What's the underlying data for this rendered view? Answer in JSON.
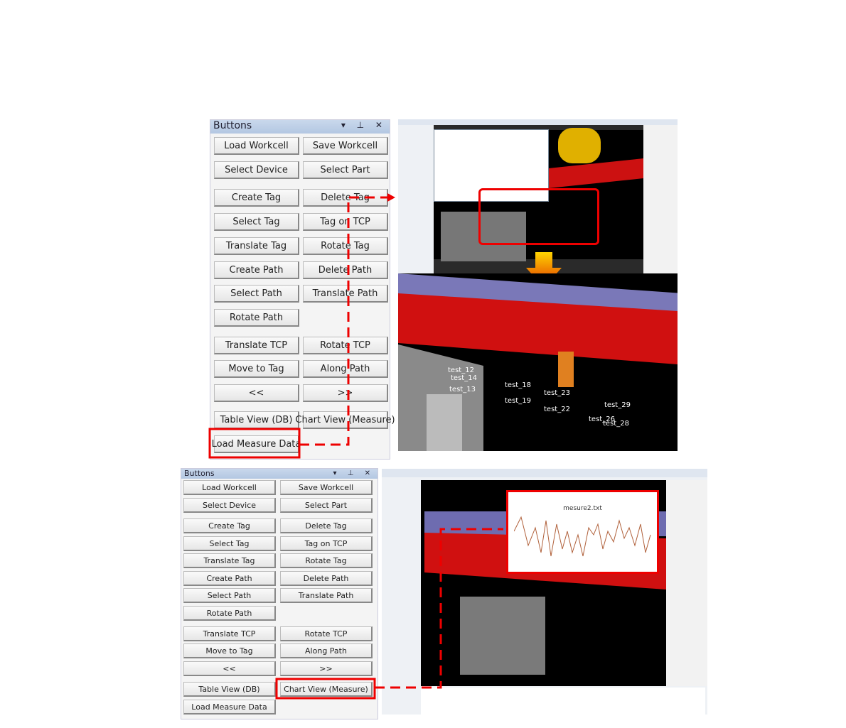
{
  "panel_title": "Buttons",
  "buttons": [
    [
      "Load Workcell",
      "Save Workcell"
    ],
    [
      "Select Device",
      "Select Part"
    ],
    [
      "Create Tag",
      "Delete Tag"
    ],
    [
      "Select Tag",
      "Tag on TCP"
    ],
    [
      "Translate Tag",
      "Rotate Tag"
    ],
    [
      "Create Path",
      "Delete Path"
    ],
    [
      "Select Path",
      "Translate Path"
    ],
    [
      "Rotate Path",
      ""
    ],
    [
      "Translate TCP",
      "Rotate TCP"
    ],
    [
      "Move to Tag",
      "Along Path"
    ],
    [
      "<<",
      ">>"
    ],
    [
      "Table View (DB)",
      "Chart View (Measure)"
    ],
    [
      "Load Measure Data",
      ""
    ]
  ],
  "tags": [
    "test_12",
    "test_14",
    "test_13",
    "test_18",
    "test_19",
    "test_23",
    "test_22",
    "test_29",
    "test_26",
    "test_28"
  ],
  "chart_window": {
    "title": "mesure2.txt"
  },
  "colors": {
    "highlight": "#e00000",
    "robot_rail": "#d01010",
    "titlebar": "#b3c7e2"
  }
}
